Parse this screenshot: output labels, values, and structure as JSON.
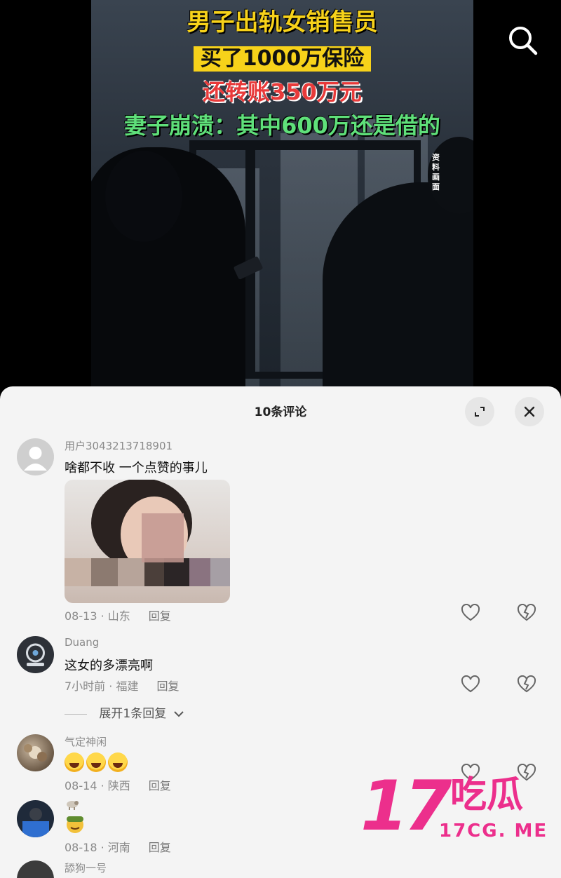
{
  "video": {
    "caption_line1": "男子出轨女销售员",
    "caption_line2": "买了1000万保险",
    "caption_line3": "还转账350万元",
    "caption_line4": "妻子崩溃：其中600万还是借的",
    "side_note": "资料画面"
  },
  "sheet": {
    "title": "10条评论"
  },
  "comments": [
    {
      "user": "用户3043213718901",
      "text": "啥都不收 一个点赞的事儿",
      "date": "08-13",
      "location": "山东",
      "reply": "回复"
    },
    {
      "user": "Duang",
      "text": "这女的多漂亮啊",
      "date": "7小时前",
      "location": "福建",
      "reply": "回复",
      "expand": "展开1条回复"
    },
    {
      "user": "气定神闲",
      "text": "",
      "date": "08-14",
      "location": "陕西",
      "reply": "回复"
    },
    {
      "user": "",
      "text": "",
      "date": "08-18",
      "location": "河南",
      "reply": "回复"
    },
    {
      "user": "舔狗一号"
    }
  ],
  "watermark": {
    "number": "17",
    "chinese": "吃瓜",
    "url": "17CG. ME"
  },
  "colors": {
    "caption_yellow": "#f7d21a",
    "caption_red": "#e83a3a",
    "caption_green": "#5fe07a",
    "watermark_pink": "#ec2f8c"
  }
}
